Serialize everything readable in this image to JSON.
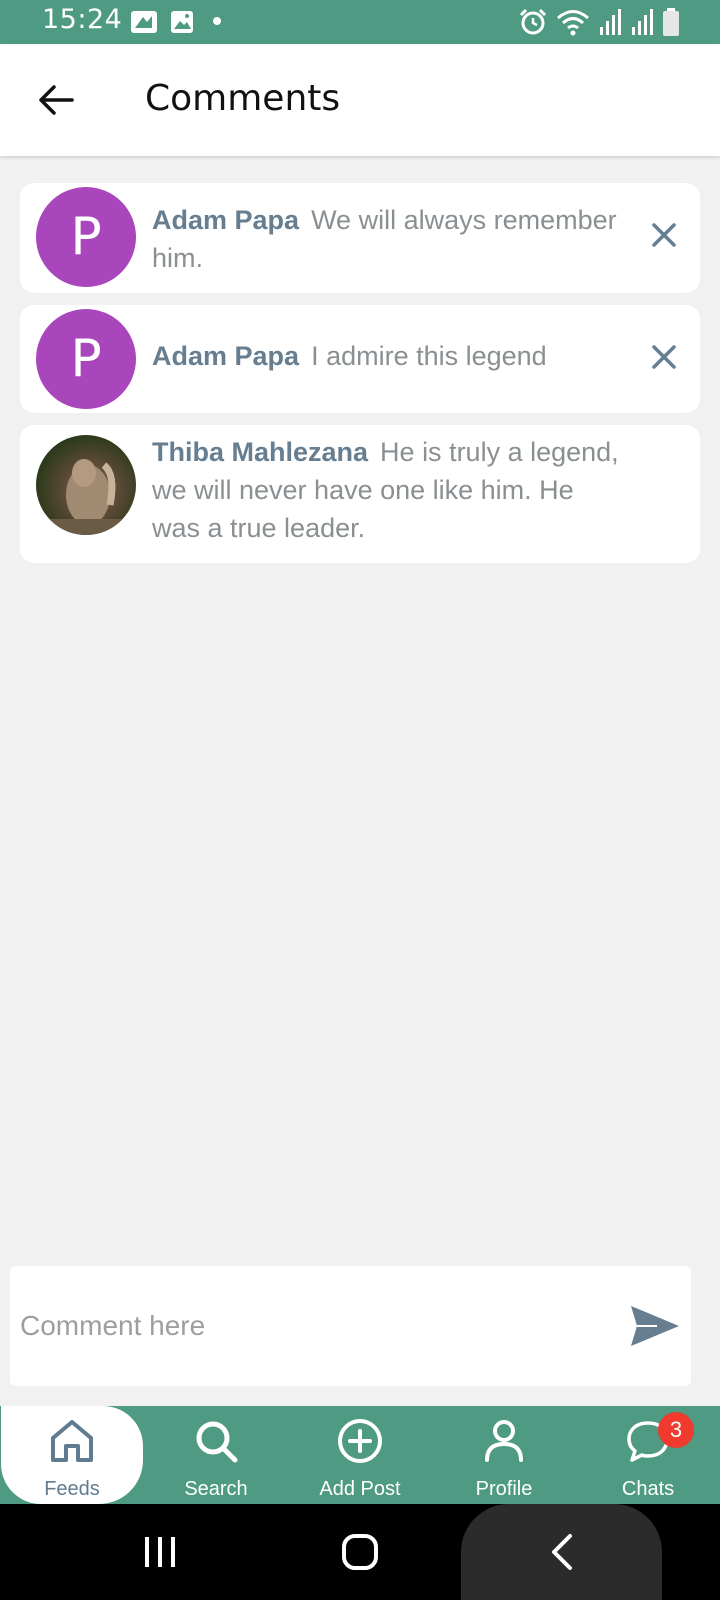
{
  "status_bar": {
    "time": "15:24"
  },
  "header": {
    "title": "Comments"
  },
  "comments": [
    {
      "avatar_letter": "P",
      "author": "Adam Papa",
      "text": "We will always remember him.",
      "removable": true
    },
    {
      "avatar_letter": "P",
      "author": "Adam Papa",
      "text": "I admire this legend",
      "removable": true
    },
    {
      "avatar_letter": "",
      "author": "Thiba Mahlezana",
      "text": "He is truly a legend, we will never have one like him. He was a true leader.",
      "removable": false
    }
  ],
  "comment_input": {
    "placeholder": "Comment here",
    "value": ""
  },
  "bottom_nav": {
    "items": [
      {
        "label": "Feeds",
        "icon": "home-icon",
        "active": true
      },
      {
        "label": "Search",
        "icon": "search-icon"
      },
      {
        "label": "Add Post",
        "icon": "add-circle-icon"
      },
      {
        "label": "Profile",
        "icon": "person-icon"
      },
      {
        "label": "Chats",
        "icon": "chat-icon",
        "badge": "3"
      }
    ]
  },
  "colors": {
    "status_bar": "#4f9a82",
    "nav_bar": "#4f9a82",
    "avatar": "#a946bb",
    "author": "#667e8f",
    "badge": "#f03a2e"
  }
}
